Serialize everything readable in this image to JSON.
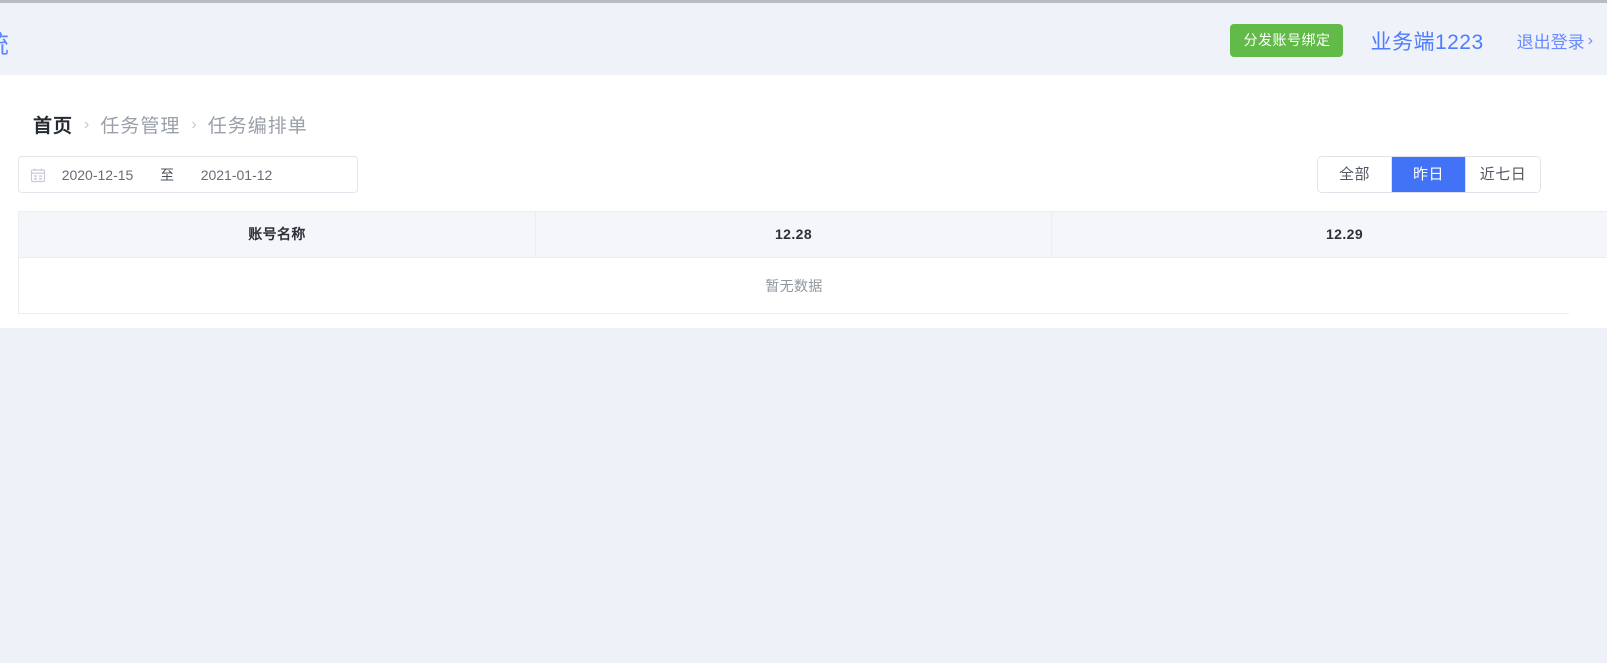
{
  "header": {
    "app_title": "系统",
    "bind_button_label": "分发账号绑定",
    "user_label": "业务端1223",
    "logout_label": "退出登录",
    "logout_chevron": "›",
    "bg_color": "#eff2f8",
    "bind_button_color": "#62ba49",
    "link_color": "#4d7cff"
  },
  "breadcrumb": {
    "home": "首页",
    "separator": "›",
    "level2": "任务管理",
    "level3": "任务编排单"
  },
  "filters": {
    "date_range": {
      "start": "2020-12-15",
      "separator": "至",
      "end": "2021-01-12",
      "icon": "calendar-icon"
    },
    "quick_ranges": [
      {
        "label": "全部",
        "active": false
      },
      {
        "label": "昨日",
        "active": true
      },
      {
        "label": "近七日",
        "active": false
      }
    ],
    "active_color": "#4272f5"
  },
  "table": {
    "columns": [
      "账号名称",
      "12.28",
      "12.29"
    ],
    "rows": [],
    "empty_text": "暂无数据",
    "header_bg": "#f5f6fa",
    "border_color": "#ebedf2"
  }
}
